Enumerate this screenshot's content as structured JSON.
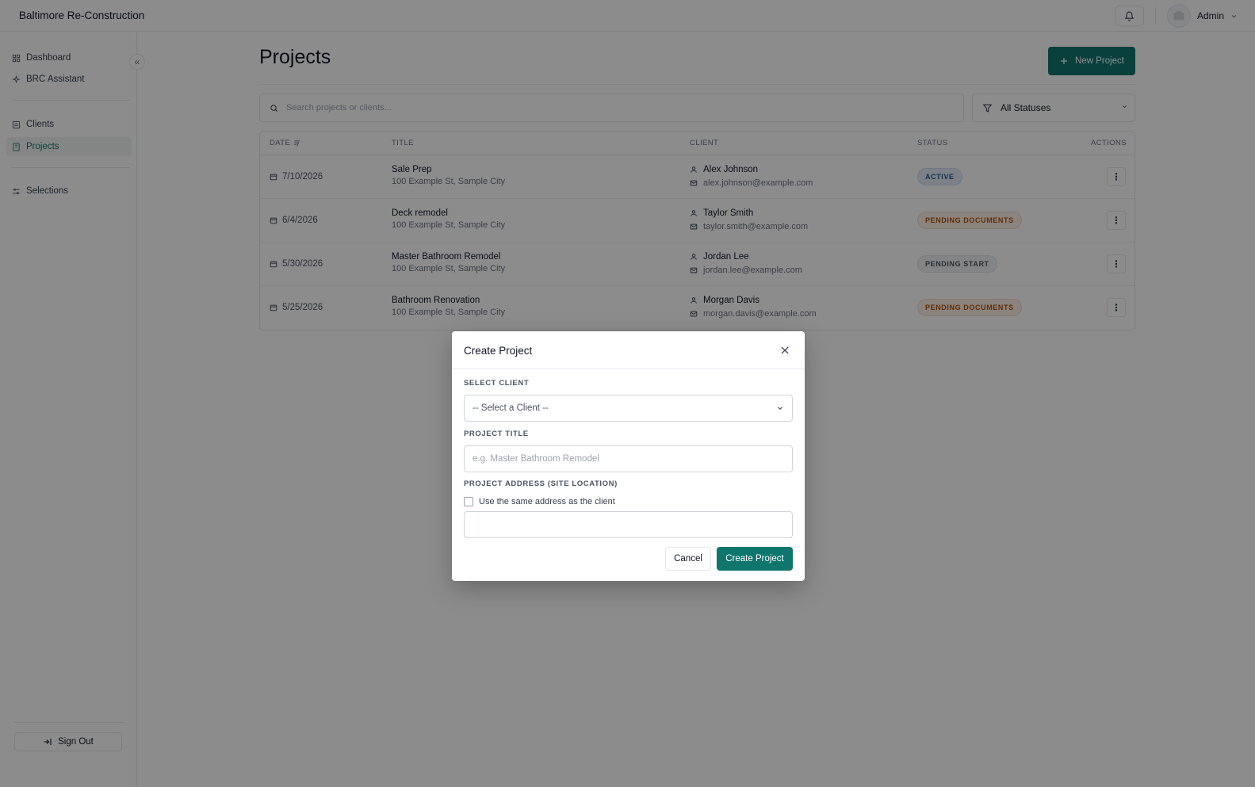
{
  "app": {
    "brand": "Baltimore Re-Construction"
  },
  "header": {
    "user_name": "Admin"
  },
  "sidebar": {
    "items": [
      {
        "label": "Dashboard",
        "icon": "dashboard-grid-icon"
      },
      {
        "label": "BRC Assistant",
        "icon": "sparkle-icon"
      },
      {
        "label": "Clients",
        "icon": "clients-icon"
      },
      {
        "label": "Projects",
        "icon": "projects-icon",
        "active": true
      },
      {
        "label": "Selections",
        "icon": "selections-icon"
      }
    ],
    "sign_out": "Sign Out"
  },
  "main": {
    "title": "Projects",
    "new_button": "New Project",
    "search_placeholder": "Search projects or clients...",
    "status_filter": "All Statuses",
    "columns": {
      "date": "DATE",
      "title": "TITLE",
      "client": "CLIENT",
      "status": "STATUS",
      "actions": "ACTIONS"
    },
    "rows": [
      {
        "date": "7/10/2026",
        "title": "Sale Prep",
        "address": "100 Example St, Sample City",
        "client": "Alex Johnson",
        "email": "alex.johnson@example.com",
        "status": "ACTIVE"
      },
      {
        "date": "6/4/2026",
        "title": "Deck remodel",
        "address": "100 Example St, Sample City",
        "client": "Taylor Smith",
        "email": "taylor.smith@example.com",
        "status": "PENDING DOCUMENTS"
      },
      {
        "date": "5/30/2026",
        "title": "Master Bathroom Remodel",
        "address": "100 Example St, Sample City",
        "client": "Jordan Lee",
        "email": "jordan.lee@example.com",
        "status": "PENDING START"
      },
      {
        "date": "5/25/2026",
        "title": "Bathroom Renovation",
        "address": "100 Example St, Sample City",
        "client": "Morgan Davis",
        "email": "morgan.davis@example.com",
        "status": "PENDING DOCUMENTS"
      }
    ]
  },
  "modal": {
    "title": "Create Project",
    "select_client_label": "SELECT CLIENT",
    "select_client_value": "-- Select a Client --",
    "project_title_label": "PROJECT TITLE",
    "project_title_placeholder": "e.g. Master Bathroom Remodel",
    "project_address_label": "PROJECT ADDRESS (SITE LOCATION)",
    "same_address_label": "Use the same address as the client",
    "address_value": "",
    "cancel": "Cancel",
    "create": "Create Project"
  },
  "colors": {
    "accent": "#0f766e",
    "active_badge": "#1e5b8c",
    "pending_docs_badge": "#b45309",
    "pending_start_badge": "#4b5563"
  }
}
